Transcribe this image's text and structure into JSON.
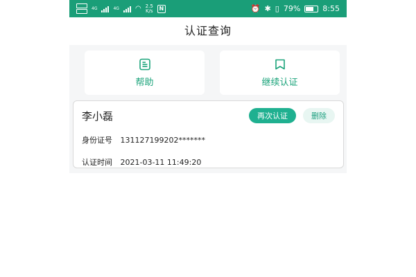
{
  "status_bar": {
    "network_1": "4G",
    "network_2": "4G",
    "speed_value": "2.5",
    "speed_unit": "K/s",
    "battery": "79%",
    "time": "8:55"
  },
  "header": {
    "title": "认证查询"
  },
  "actions": [
    {
      "label": "帮助",
      "icon": "help-doc-icon"
    },
    {
      "label": "继续认证",
      "icon": "bookmark-icon"
    }
  ],
  "record": {
    "name": "李小磊",
    "reauth_label": "再次认证",
    "delete_label": "删除",
    "id_label": "身份证号",
    "id_value": "131127199202*******",
    "time_label": "认证时间",
    "time_value": "2021-03-11 11:49:20"
  },
  "colors": {
    "status_bar": "#1a9e78",
    "accent": "#1fb090"
  }
}
